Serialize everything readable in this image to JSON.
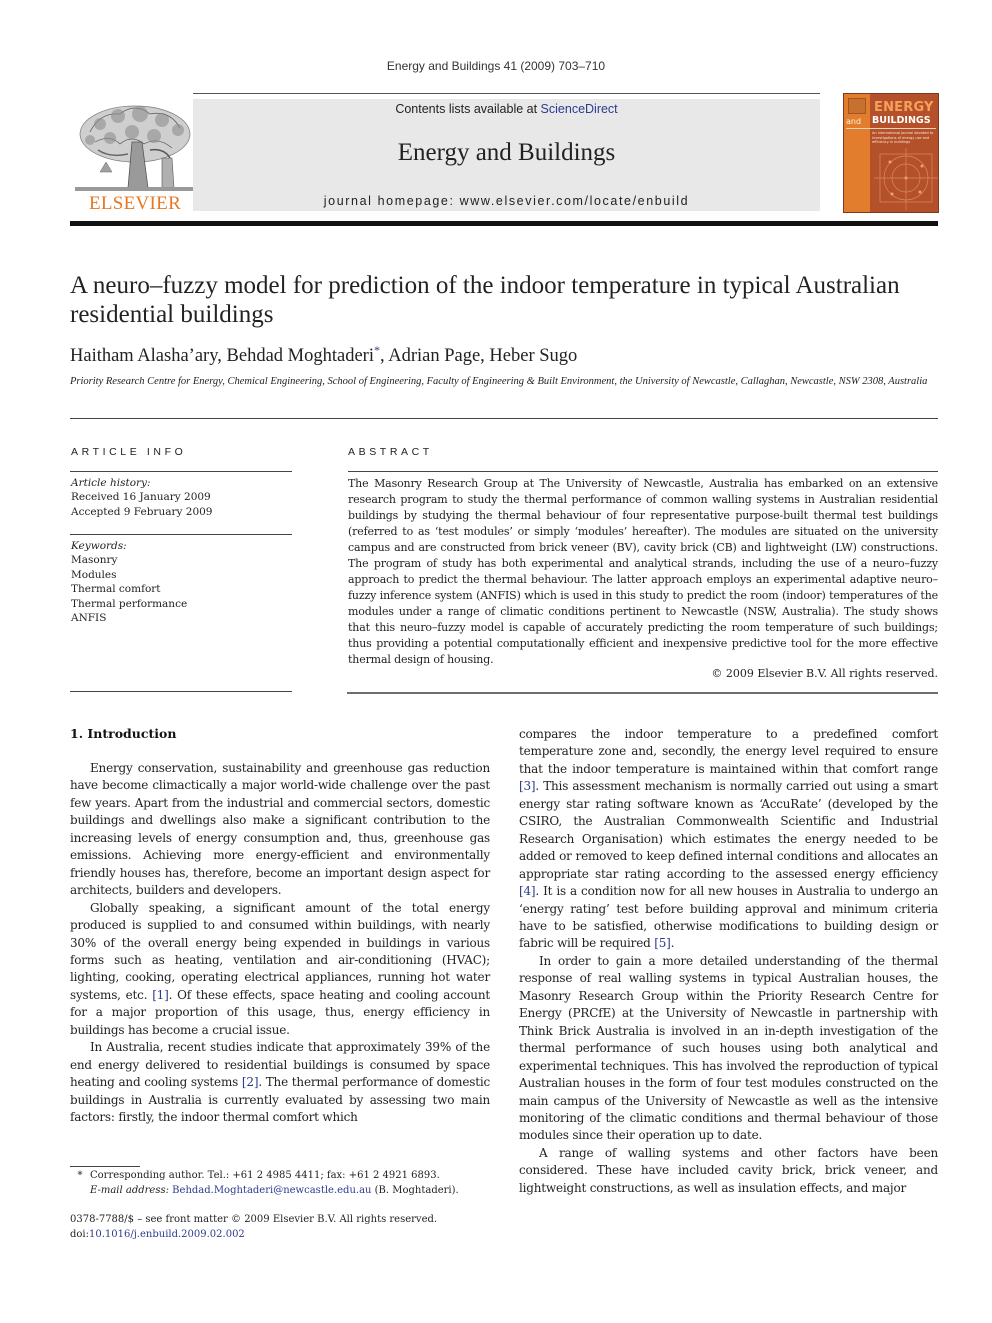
{
  "header": {
    "journal_ref": "Energy and Buildings 41 (2009) 703–710",
    "contents_prefix": "Contents lists available at ",
    "contents_link": "ScienceDirect",
    "journal_name": "Energy and Buildings",
    "homepage_prefix": "journal homepage: ",
    "homepage_url": "www.elsevier.com/locate/enbuild",
    "publisher_logo": "ELSEVIER",
    "cover": {
      "line1": "ENERGY",
      "and": "and",
      "line2": "BUILDINGS",
      "subtitle": "An international journal devoted to investigations of energy use and efficiency in buildings"
    },
    "colors": {
      "elsevier_orange": "#e87722",
      "link_blue": "#2b3a8f",
      "cover_brown": "#b5512a"
    }
  },
  "article": {
    "title": "A neuro–fuzzy model for prediction of the indoor temperature in typical Australian residential buildings",
    "authors": [
      {
        "name": "Haitham Alasha’ary",
        "sep": ", "
      },
      {
        "name": "Behdad Moghtaderi",
        "mark": "*",
        "sep": ", "
      },
      {
        "name": "Adrian Page",
        "sep": ", "
      },
      {
        "name": "Heber Sugo",
        "sep": ""
      }
    ],
    "affiliation": "Priority Research Centre for Energy, Chemical Engineering, School of Engineering, Faculty of Engineering & Built Environment, the University of Newcastle, Callaghan, Newcastle, NSW 2308, Australia"
  },
  "article_info": {
    "label": "ARTICLE INFO",
    "history_heading": "Article history:",
    "received": "Received 16 January 2009",
    "accepted": "Accepted 9 February 2009",
    "keywords_heading": "Keywords:",
    "keywords": [
      "Masonry",
      "Modules",
      "Thermal comfort",
      "Thermal performance",
      "ANFIS"
    ]
  },
  "abstract": {
    "label": "ABSTRACT",
    "text": "The Masonry Research Group at The University of Newcastle, Australia has embarked on an extensive research program to study the thermal performance of common walling systems in Australian residential buildings by studying the thermal behaviour of four representative purpose-built thermal test buildings (referred to as ‘test modules’ or simply ‘modules’ hereafter). The modules are situated on the university campus and are constructed from brick veneer (BV), cavity brick (CB) and lightweight (LW) constructions. The program of study has both experimental and analytical strands, including the use of a neuro–fuzzy approach to predict the thermal behaviour. The latter approach employs an experimental adaptive neuro–fuzzy inference system (ANFIS) which is used in this study to predict the room (indoor) temperatures of the modules under a range of climatic conditions pertinent to Newcastle (NSW, Australia). The study shows that this neuro–fuzzy model is capable of accurately predicting the room temperature of such buildings; thus providing a potential computationally efficient and inexpensive predictive tool for the more effective thermal design of housing.",
    "copyright": "© 2009 Elsevier B.V. All rights reserved."
  },
  "body": {
    "section_heading": "1.  Introduction",
    "left": {
      "p1": "Energy conservation, sustainability and greenhouse gas reduction have become climactically a major world-wide challenge over the past few years. Apart from the industrial and commercial sectors, domestic buildings and dwellings also make a significant contribution to the increasing levels of energy consumption and, thus, greenhouse gas emissions. Achieving more energy-efficient and environmentally friendly houses has, therefore, become an important design aspect for architects, builders and developers.",
      "p2_a": "Globally speaking, a significant amount of the total energy produced is supplied to and consumed within buildings, with nearly 30% of the overall energy being expended in buildings in various forms such as heating, ventilation and air-conditioning (HVAC); lighting, cooking, operating electrical appliances, running hot water systems, etc. ",
      "p2_ref": "[1]",
      "p2_b": ". Of these effects, space heating and cooling account for a major proportion of this usage, thus, energy efficiency in buildings has become a crucial issue.",
      "p3_a": "In Australia, recent studies indicate that approximately 39% of the end energy delivered to residential buildings is consumed by space heating and cooling systems ",
      "p3_ref": "[2]",
      "p3_b": ". The thermal performance of domestic buildings in Australia is currently evaluated by assessing two main factors: firstly, the indoor thermal comfort which"
    },
    "right": {
      "p1_a": "compares the indoor temperature to a predefined comfort temperature zone and, secondly, the energy level required to ensure that the indoor temperature is maintained within that comfort range ",
      "p1_ref1": "[3]",
      "p1_b": ". This assessment mechanism is normally carried out using a smart energy star rating software known as ‘AccuRate’ (developed by the CSIRO, the Australian Commonwealth Scientific and Industrial Research Organisation) which estimates the energy needed to be added or removed to keep defined internal conditions and allocates an appropriate star rating according to the assessed energy efficiency ",
      "p1_ref2": "[4]",
      "p1_c": ". It is a condition now for all new houses in Australia to undergo an ‘energy rating’ test before building approval and minimum criteria have to be satisfied, otherwise modifications to building design or fabric will be required ",
      "p1_ref3": "[5]",
      "p1_d": ".",
      "p2": "In order to gain a more detailed understanding of the thermal response of real walling systems in typical Australian houses, the Masonry Research Group within the Priority Research Centre for Energy (PRCfE) at the University of Newcastle in partnership with Think Brick Australia is involved in an in-depth investigation of the thermal performance of such houses using both analytical and experimental techniques. This has involved the reproduction of typical Australian houses in the form of four test modules constructed on the main campus of the University of Newcastle as well as the intensive monitoring of the climatic conditions and thermal behaviour of those modules since their operation up to date.",
      "p3": "A range of walling systems and other factors have been considered. These have included cavity brick, brick veneer, and lightweight constructions, as well as insulation effects, and major"
    }
  },
  "footnote": {
    "mark": "*",
    "corresponding": "Corresponding author. Tel.: +61 2 4985 4411; fax: +61 2 4921 6893.",
    "email_label": "E-mail address: ",
    "email": "Behdad.Moghtaderi@newcastle.edu.au",
    "email_suffix": " (B. Moghtaderi).",
    "front_matter": "0378-7788/$ – see front matter © 2009 Elsevier B.V. All rights reserved.",
    "doi_prefix": "doi:",
    "doi": "10.1016/j.enbuild.2009.02.002"
  }
}
